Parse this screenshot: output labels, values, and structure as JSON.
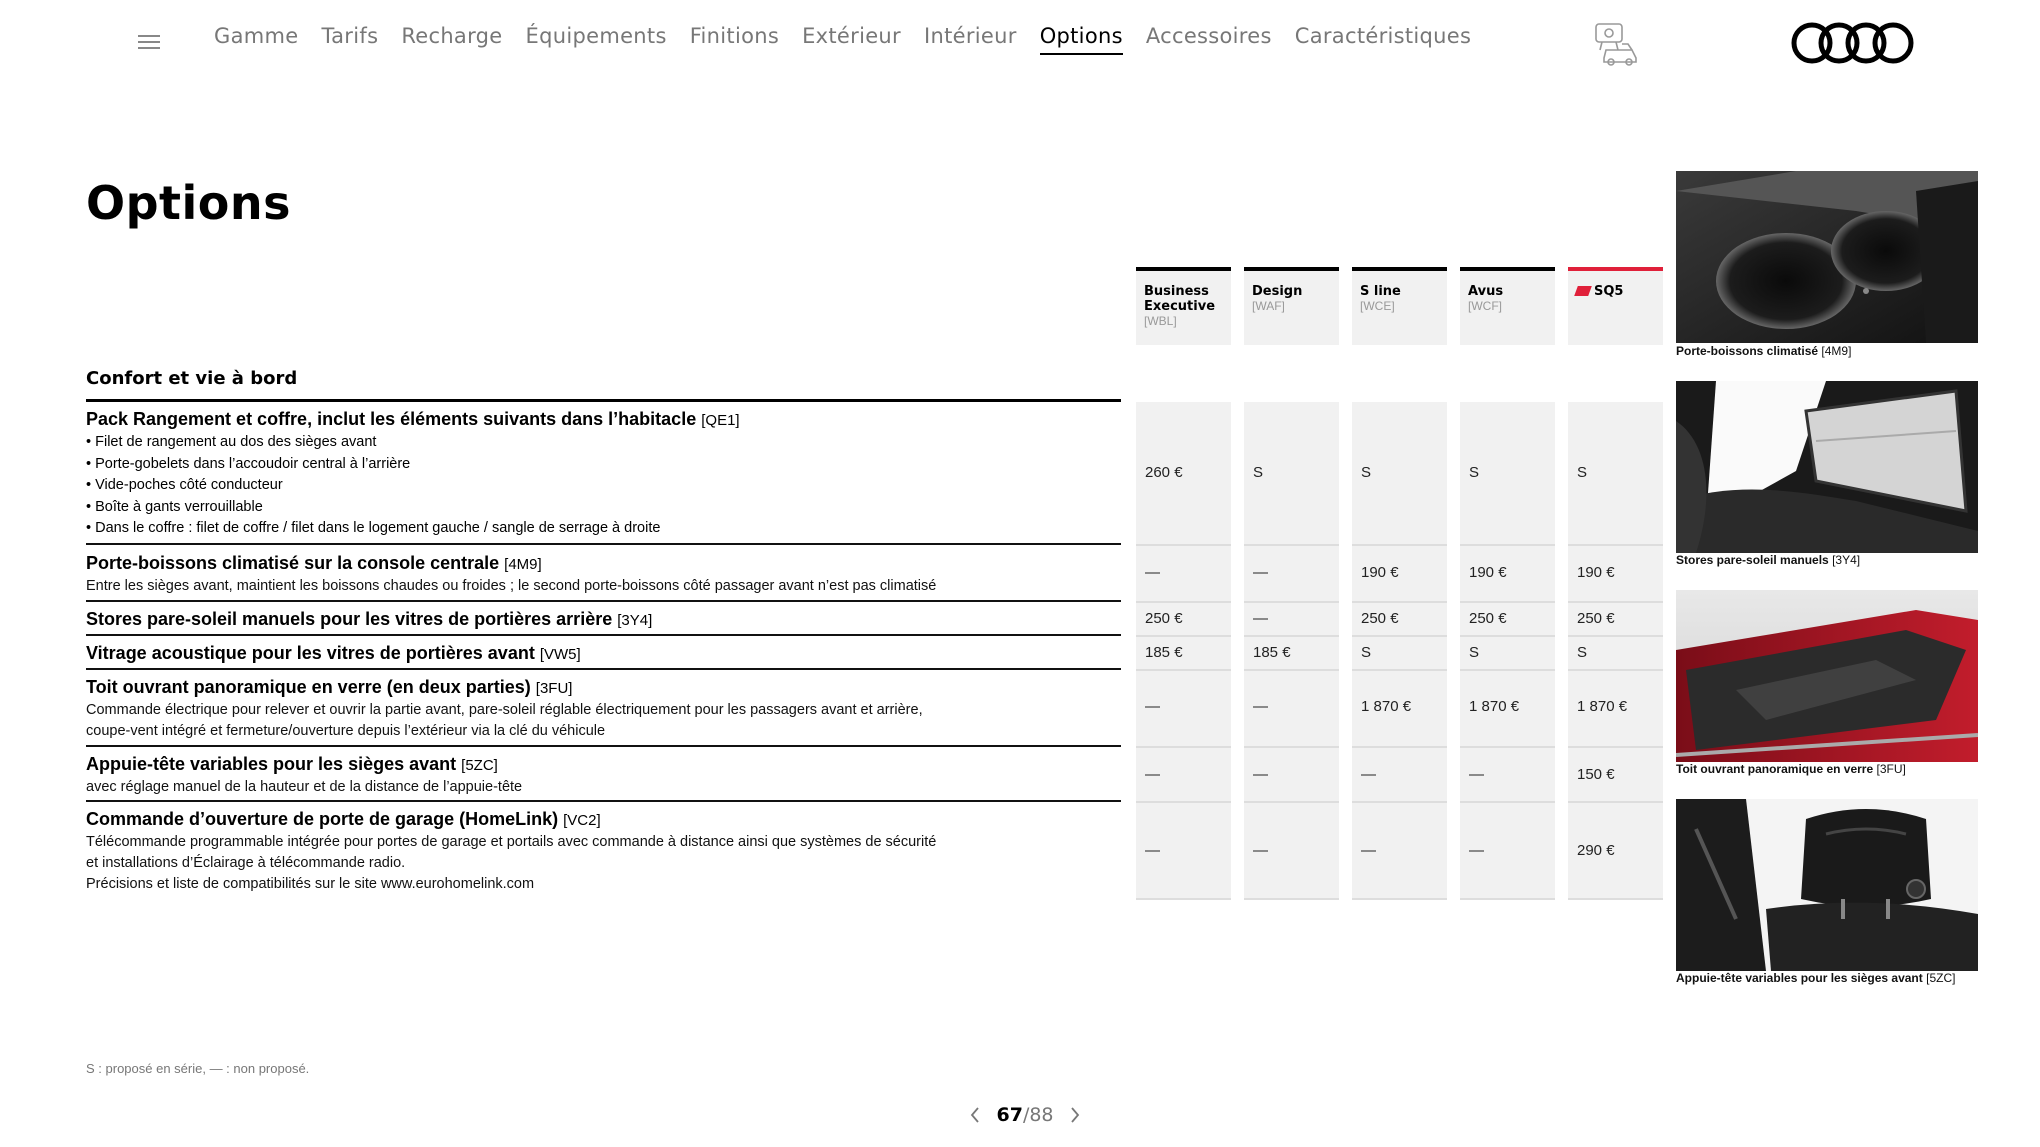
{
  "nav": {
    "items": [
      {
        "label": "Gamme",
        "active": false
      },
      {
        "label": "Tarifs",
        "active": false
      },
      {
        "label": "Recharge",
        "active": false
      },
      {
        "label": "Équipements",
        "active": false
      },
      {
        "label": "Finitions",
        "active": false
      },
      {
        "label": "Extérieur",
        "active": false
      },
      {
        "label": "Intérieur",
        "active": false
      },
      {
        "label": "Options",
        "active": true
      },
      {
        "label": "Accessoires",
        "active": false
      },
      {
        "label": "Caractéristiques",
        "active": false
      }
    ]
  },
  "page": {
    "title": "Options"
  },
  "columns": [
    {
      "name": "Business Executive",
      "code": "[WBL]"
    },
    {
      "name": "Design",
      "code": "[WAF]"
    },
    {
      "name": "S line",
      "code": "[WCE]"
    },
    {
      "name": "Avus",
      "code": "[WCF]"
    },
    {
      "name": "SQ5",
      "code": ""
    }
  ],
  "section": {
    "title": "Confort et vie à bord"
  },
  "rows": [
    {
      "title": "Pack Rangement et coffre, inclut les éléments suivants dans l’habitacle",
      "code": "[QE1]",
      "bullets": [
        "Filet de rangement au dos des sièges avant",
        "Porte-gobelets dans l’accoudoir central à l’arrière",
        "Vide-poches côté conducteur",
        "Boîte à gants verrouillable",
        "Dans le coffre : filet de coffre / filet dans le logement gauche / sangle de serrage à droite"
      ],
      "values": [
        "260 €",
        "S",
        "S",
        "S",
        "S"
      ]
    },
    {
      "title": "Porte-boissons climatisé sur la console centrale",
      "code": "[4M9]",
      "desc": [
        "Entre les sièges avant, maintient les boissons chaudes ou froides ; le second porte-boissons côté passager avant n’est pas climatisé"
      ],
      "values": [
        "—",
        "—",
        "190 €",
        "190 €",
        "190 €"
      ]
    },
    {
      "title": "Stores pare-soleil manuels pour les vitres de portières arrière",
      "code": "[3Y4]",
      "values": [
        "250 €",
        "—",
        "250 €",
        "250 €",
        "250 €"
      ]
    },
    {
      "title": "Vitrage acoustique pour les vitres de portières avant",
      "code": "[VW5]",
      "values": [
        "185 €",
        "185 €",
        "S",
        "S",
        "S"
      ]
    },
    {
      "title": "Toit ouvrant panoramique en verre (en deux parties)",
      "code": "[3FU]",
      "desc": [
        "Commande électrique pour relever et ouvrir la partie avant, pare-soleil réglable électriquement pour les passagers avant et arrière,",
        "coupe-vent intégré et fermeture/ouverture depuis l’extérieur via la clé du véhicule"
      ],
      "values": [
        "—",
        "—",
        "1 870 €",
        "1 870 €",
        "1 870 €"
      ]
    },
    {
      "title": "Appuie-tête variables pour les sièges avant",
      "code": "[5ZC]",
      "desc": [
        "avec réglage manuel de la hauteur et de la distance de l’appuie-tête"
      ],
      "values": [
        "—",
        "—",
        "—",
        "—",
        "150 €"
      ]
    },
    {
      "title": "Commande d’ouverture de porte de garage (HomeLink)",
      "code": "[VC2]",
      "desc": [
        "Télécommande programmable intégrée pour portes de garage et portails avec commande à distance ainsi que systèmes de sécurité",
        "et installations d’Éclairage à télécommande radio.",
        "Précisions et liste de compatibilités sur le site www.eurohomelink.com"
      ],
      "values": [
        "—",
        "—",
        "—",
        "—",
        "290 €"
      ]
    }
  ],
  "photos": [
    {
      "caption": "Porte-boissons climatisé",
      "code": "[4M9]",
      "icon": "cupholder-photo"
    },
    {
      "caption": "Stores pare-soleil manuels",
      "code": "[3Y4]",
      "icon": "sunblind-photo"
    },
    {
      "caption": "Toit ouvrant panoramique en verre",
      "code": "[3FU]",
      "icon": "sunroof-photo"
    },
    {
      "caption": "Appuie-tête variables pour les sièges avant",
      "code": "[5ZC]",
      "icon": "headrest-photo"
    }
  ],
  "footnote": "S : proposé en série, — : non proposé.",
  "pager": {
    "current": "67",
    "total": "/88"
  },
  "colors": {
    "accent_red": "#e0203a",
    "column_bg": "#f1f1f1"
  }
}
